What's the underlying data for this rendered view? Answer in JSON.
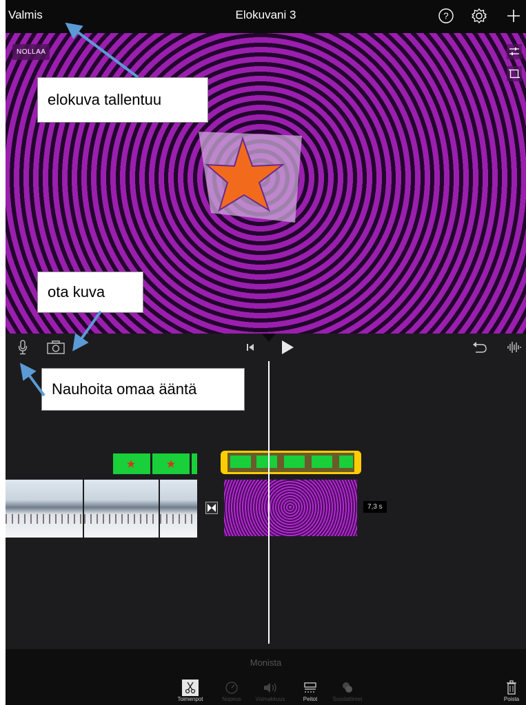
{
  "topbar": {
    "done_label": "Valmis",
    "project_title": "Elokuvani 3",
    "help_icon": "question-circle-icon",
    "settings_icon": "gear-icon",
    "add_icon": "plus-icon"
  },
  "viewer": {
    "reset_label": "NOLLAA",
    "adjust_icon": "sliders-icon",
    "crop_icon": "crop-icon"
  },
  "controls": {
    "mic_icon": "microphone-icon",
    "camera_icon": "camera-icon",
    "skip_back_icon": "skip-to-start-icon",
    "play_icon": "play-icon",
    "undo_icon": "undo-icon",
    "waveform_icon": "waveform-icon"
  },
  "timeline": {
    "clip_duration": "7,3 s"
  },
  "bottombar": {
    "duplicate_label": "Monista",
    "tools": [
      {
        "label": "Toimenpot",
        "icon": "scissors-icon"
      },
      {
        "label": "Nopeus",
        "icon": "speedometer-icon"
      },
      {
        "label": "Voimakkuus",
        "icon": "volume-icon"
      },
      {
        "label": "Peitot",
        "icon": "overlay-icon"
      },
      {
        "label": "Suodattimet",
        "icon": "filters-icon"
      }
    ],
    "delete_label": "Poista"
  },
  "annotations": {
    "save_note": "elokuva tallentuu",
    "photo_note": "ota kuva",
    "record_note": "Nauhoita omaa ääntä"
  },
  "colors": {
    "accent": "#ffcc00",
    "clip_green": "#19cf3a",
    "spiral_purple": "#9a1fae",
    "arrow_blue": "#5b9bd5"
  }
}
